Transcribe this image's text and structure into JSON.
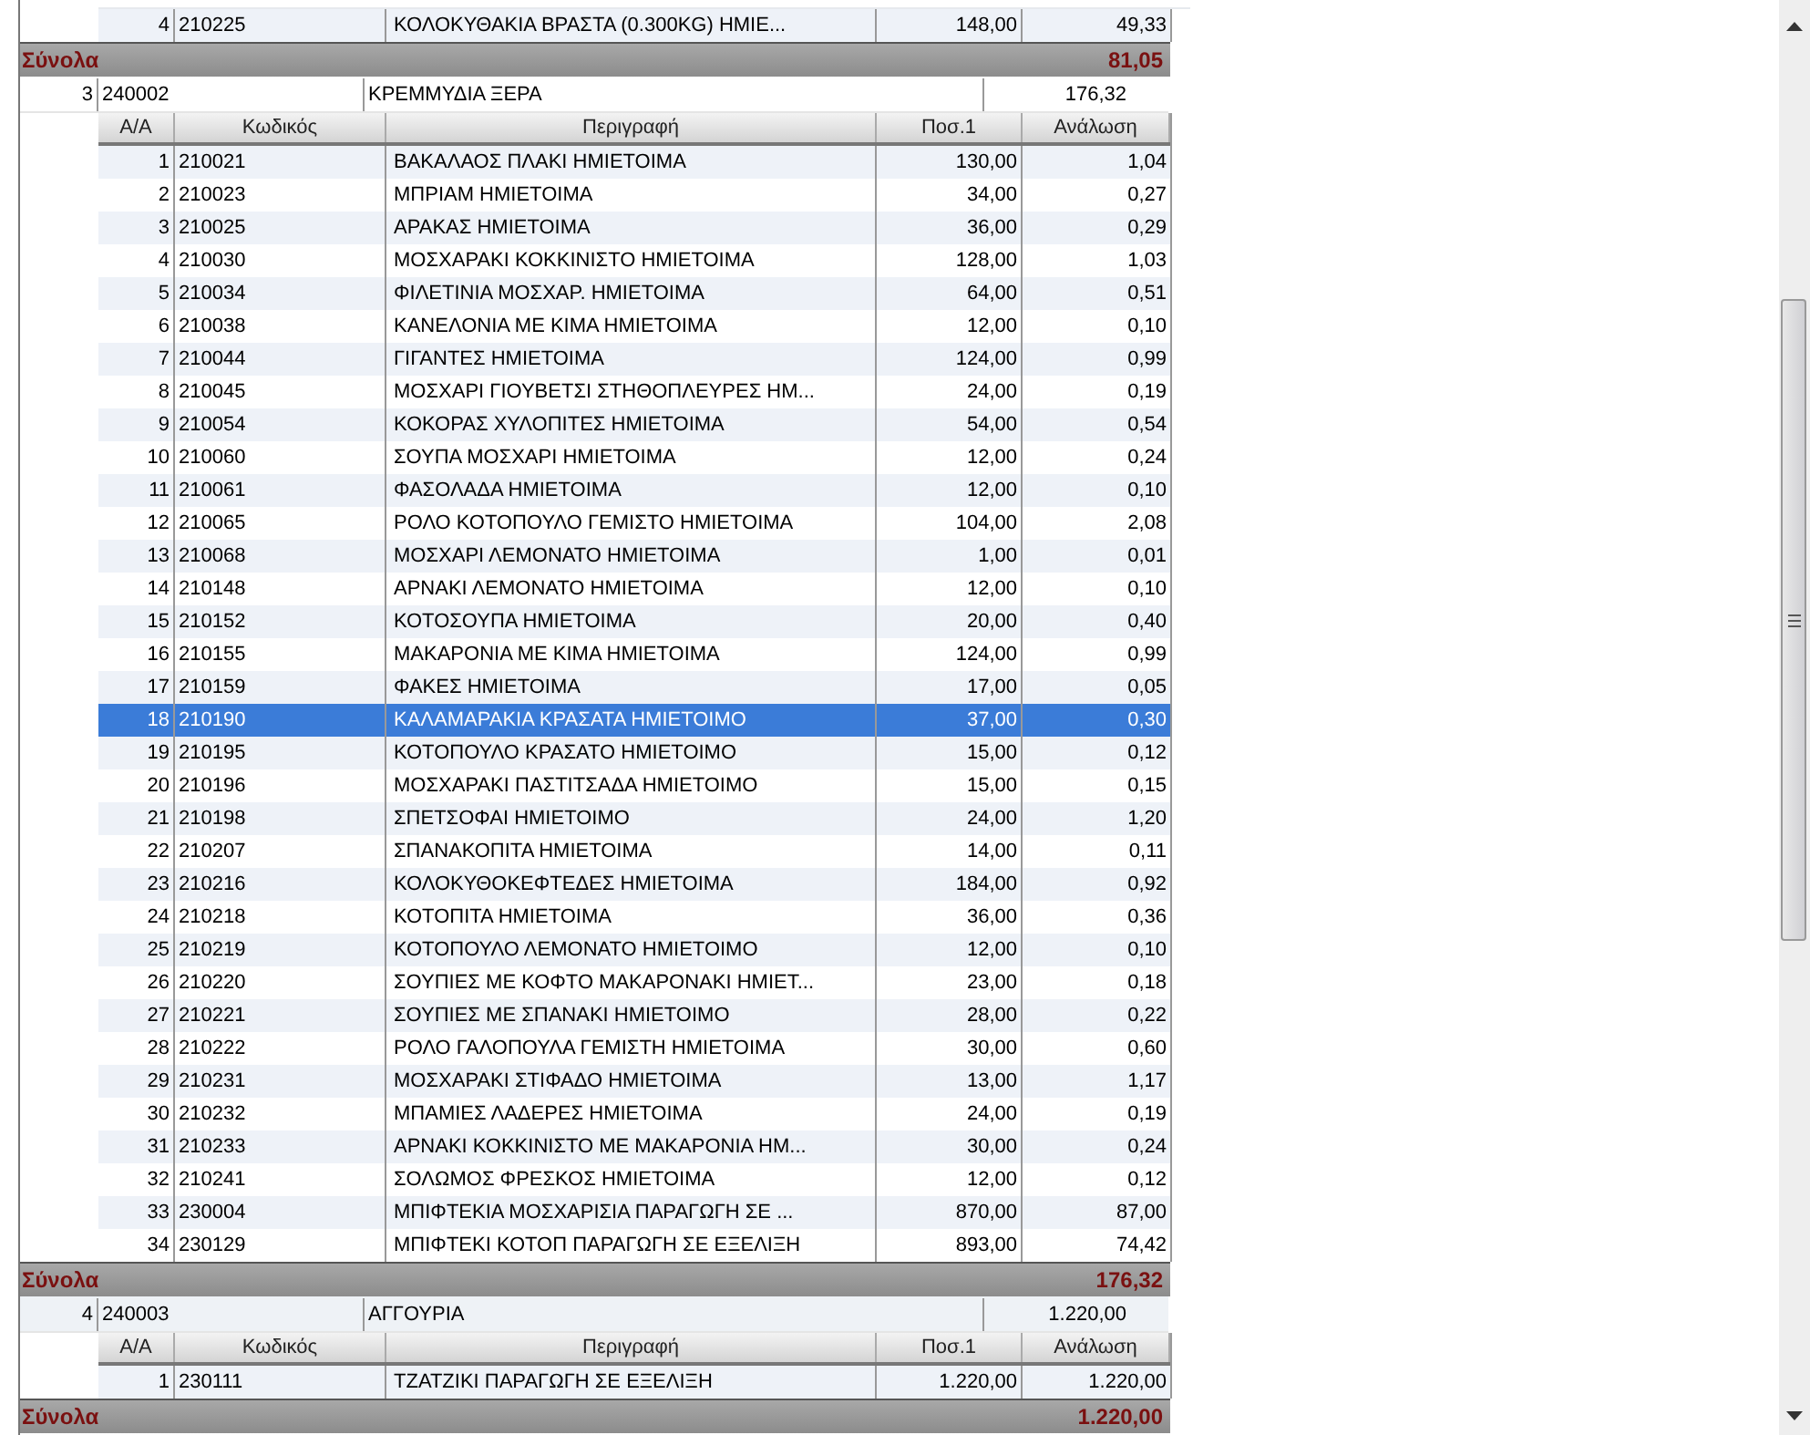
{
  "groups": [
    {
      "items": [
        {
          "aa": "4",
          "code": "210225",
          "description": "ΚΟΛΟΚΥΘΑΚΙΑ ΒΡΑΣΤΑ (0.300KG) ΗΜΙΕ...",
          "qty": "148,00",
          "consumption": "49,33",
          "selected": false
        }
      ],
      "totals": {
        "label": "Σύνολα",
        "value": "81,05"
      }
    },
    {
      "master": {
        "aa": "3",
        "code": "240002",
        "description": "ΚΡΕΜΜΥΔΙΑ ΞΕΡΑ",
        "value": "176,32"
      },
      "columns": [
        "Α/Α",
        "Κωδικός",
        "Περιγραφή",
        "Ποσ.1",
        "Ανάλωση"
      ],
      "items": [
        {
          "aa": "1",
          "code": "210021",
          "description": "ΒΑΚΑΛΑΟΣ ΠΛΑΚΙ ΗΜΙΕΤΟΙΜΑ",
          "qty": "130,00",
          "consumption": "1,04",
          "selected": false
        },
        {
          "aa": "2",
          "code": "210023",
          "description": "ΜΠΡΙΑΜ ΗΜΙΕΤΟΙΜΑ",
          "qty": "34,00",
          "consumption": "0,27",
          "selected": false
        },
        {
          "aa": "3",
          "code": "210025",
          "description": "ΑΡΑΚΑΣ ΗΜΙΕΤΟΙΜΑ",
          "qty": "36,00",
          "consumption": "0,29",
          "selected": false
        },
        {
          "aa": "4",
          "code": "210030",
          "description": "ΜΟΣΧΑΡΑΚΙ ΚΟΚΚΙΝΙΣΤΟ ΗΜΙΕΤΟΙΜΑ",
          "qty": "128,00",
          "consumption": "1,03",
          "selected": false
        },
        {
          "aa": "5",
          "code": "210034",
          "description": "ΦΙΛΕΤΙΝΙΑ ΜΟΣΧΑΡ. ΗΜΙΕΤΟΙΜΑ",
          "qty": "64,00",
          "consumption": "0,51",
          "selected": false
        },
        {
          "aa": "6",
          "code": "210038",
          "description": "ΚΑΝΕΛΟΝΙΑ ΜΕ ΚΙΜΑ ΗΜΙΕΤΟΙΜΑ",
          "qty": "12,00",
          "consumption": "0,10",
          "selected": false
        },
        {
          "aa": "7",
          "code": "210044",
          "description": "ΓΙΓΑΝΤΕΣ ΗΜΙΕΤΟΙΜΑ",
          "qty": "124,00",
          "consumption": "0,99",
          "selected": false
        },
        {
          "aa": "8",
          "code": "210045",
          "description": "ΜΟΣΧΑΡΙ ΓΙΟΥΒΕΤΣΙ ΣΤΗΘΟΠΛΕΥΡΕΣ ΗΜ...",
          "qty": "24,00",
          "consumption": "0,19",
          "selected": false
        },
        {
          "aa": "9",
          "code": "210054",
          "description": "ΚΟΚΟΡΑΣ ΧΥΛΟΠΙΤΕΣ ΗΜΙΕΤΟΙΜΑ",
          "qty": "54,00",
          "consumption": "0,54",
          "selected": false
        },
        {
          "aa": "10",
          "code": "210060",
          "description": "ΣΟΥΠΑ ΜΟΣΧΑΡΙ ΗΜΙΕΤΟΙΜΑ",
          "qty": "12,00",
          "consumption": "0,24",
          "selected": false
        },
        {
          "aa": "11",
          "code": "210061",
          "description": "ΦΑΣΟΛΑΔΑ ΗΜΙΕΤΟΙΜΑ",
          "qty": "12,00",
          "consumption": "0,10",
          "selected": false
        },
        {
          "aa": "12",
          "code": "210065",
          "description": "ΡΟΛΟ ΚΟΤΟΠΟΥΛΟ ΓΕΜΙΣΤΟ ΗΜΙΕΤΟΙΜΑ",
          "qty": "104,00",
          "consumption": "2,08",
          "selected": false
        },
        {
          "aa": "13",
          "code": "210068",
          "description": "ΜΟΣΧΑΡΙ ΛΕΜΟΝΑΤΟ ΗΜΙΕΤΟΙΜΑ",
          "qty": "1,00",
          "consumption": "0,01",
          "selected": false
        },
        {
          "aa": "14",
          "code": "210148",
          "description": "ΑΡΝΑΚΙ ΛΕΜΟΝΑΤΟ ΗΜΙΕΤΟΙΜΑ",
          "qty": "12,00",
          "consumption": "0,10",
          "selected": false
        },
        {
          "aa": "15",
          "code": "210152",
          "description": "ΚΟΤΟΣΟΥΠΑ ΗΜΙΕΤΟΙΜΑ",
          "qty": "20,00",
          "consumption": "0,40",
          "selected": false
        },
        {
          "aa": "16",
          "code": "210155",
          "description": "ΜΑΚΑΡΟΝΙΑ ΜΕ ΚΙΜΑ ΗΜΙΕΤΟΙΜΑ",
          "qty": "124,00",
          "consumption": "0,99",
          "selected": false
        },
        {
          "aa": "17",
          "code": "210159",
          "description": "ΦΑΚΕΣ ΗΜΙΕΤΟΙΜΑ",
          "qty": "17,00",
          "consumption": "0,05",
          "selected": false
        },
        {
          "aa": "18",
          "code": "210190",
          "description": "ΚΑΛΑΜΑΡΑΚΙΑ ΚΡΑΣΑΤΑ ΗΜΙΕΤΟΙΜΟ",
          "qty": "37,00",
          "consumption": "0,30",
          "selected": true
        },
        {
          "aa": "19",
          "code": "210195",
          "description": "ΚΟΤΟΠΟΥΛΟ ΚΡΑΣΑΤΟ ΗΜΙΕΤΟΙΜΟ",
          "qty": "15,00",
          "consumption": "0,12",
          "selected": false
        },
        {
          "aa": "20",
          "code": "210196",
          "description": "ΜΟΣΧΑΡΑΚΙ ΠΑΣΤΙΤΣΑΔΑ ΗΜΙΕΤΟΙΜΟ",
          "qty": "15,00",
          "consumption": "0,15",
          "selected": false
        },
        {
          "aa": "21",
          "code": "210198",
          "description": "ΣΠΕΤΣΟΦΑΙ ΗΜΙΕΤΟΙΜΟ",
          "qty": "24,00",
          "consumption": "1,20",
          "selected": false
        },
        {
          "aa": "22",
          "code": "210207",
          "description": "ΣΠΑΝΑΚΟΠΙΤΑ ΗΜΙΕΤΟΙΜΑ",
          "qty": "14,00",
          "consumption": "0,11",
          "selected": false
        },
        {
          "aa": "23",
          "code": "210216",
          "description": "ΚΟΛΟΚΥΘΟΚΕΦΤΕΔΕΣ ΗΜΙΕΤΟΙΜΑ",
          "qty": "184,00",
          "consumption": "0,92",
          "selected": false
        },
        {
          "aa": "24",
          "code": "210218",
          "description": "ΚΟΤΟΠΙΤΑ ΗΜΙΕΤΟΙΜΑ",
          "qty": "36,00",
          "consumption": "0,36",
          "selected": false
        },
        {
          "aa": "25",
          "code": "210219",
          "description": "ΚΟΤΟΠΟΥΛΟ ΛΕΜΟΝΑΤΟ ΗΜΙΕΤΟΙΜΟ",
          "qty": "12,00",
          "consumption": "0,10",
          "selected": false
        },
        {
          "aa": "26",
          "code": "210220",
          "description": "ΣΟΥΠΙΕΣ ΜΕ ΚΟΦΤΟ ΜΑΚΑΡΟΝΑΚΙ ΗΜΙΕΤ...",
          "qty": "23,00",
          "consumption": "0,18",
          "selected": false
        },
        {
          "aa": "27",
          "code": "210221",
          "description": "ΣΟΥΠΙΕΣ ΜΕ ΣΠΑΝΑΚΙ ΗΜΙΕΤΟΙΜΟ",
          "qty": "28,00",
          "consumption": "0,22",
          "selected": false
        },
        {
          "aa": "28",
          "code": "210222",
          "description": "ΡΟΛΟ ΓΑΛΟΠΟΥΛΑ ΓΕΜΙΣΤΗ ΗΜΙΕΤΟΙΜΑ",
          "qty": "30,00",
          "consumption": "0,60",
          "selected": false
        },
        {
          "aa": "29",
          "code": "210231",
          "description": "ΜΟΣΧΑΡΑΚΙ ΣΤΙΦΑΔΟ ΗΜΙΕΤΟΙΜΑ",
          "qty": "13,00",
          "consumption": "1,17",
          "selected": false
        },
        {
          "aa": "30",
          "code": "210232",
          "description": "ΜΠΑΜΙΕΣ ΛΑΔΕΡΕΣ ΗΜΙΕΤΟΙΜΑ",
          "qty": "24,00",
          "consumption": "0,19",
          "selected": false
        },
        {
          "aa": "31",
          "code": "210233",
          "description": "ΑΡΝΑΚΙ ΚΟΚΚΙΝΙΣΤΟ ΜΕ ΜΑΚΑΡΟΝΙΑ ΗΜ...",
          "qty": "30,00",
          "consumption": "0,24",
          "selected": false
        },
        {
          "aa": "32",
          "code": "210241",
          "description": "ΣΟΛΩΜΟΣ ΦΡΕΣΚΟΣ ΗΜΙΕΤΟΙΜΑ",
          "qty": "12,00",
          "consumption": "0,12",
          "selected": false
        },
        {
          "aa": "33",
          "code": "230004",
          "description": "ΜΠΙΦΤΕΚΙΑ ΜΟΣΧΑΡΙΣΙΑ ΠΑΡΑΓΩΓΗ ΣΕ ...",
          "qty": "870,00",
          "consumption": "87,00",
          "selected": false
        },
        {
          "aa": "34",
          "code": "230129",
          "description": "ΜΠΙΦΤΕΚΙ ΚΟΤΟΠ ΠΑΡΑΓΩΓΗ ΣΕ ΕΞΕΛΙΞΗ",
          "qty": "893,00",
          "consumption": "74,42",
          "selected": false
        }
      ],
      "totals": {
        "label": "Σύνολα",
        "value": "176,32"
      }
    },
    {
      "master": {
        "aa": "4",
        "code": "240003",
        "description": "ΑΓΓΟΥΡΙΑ",
        "value": "1.220,00"
      },
      "columns": [
        "Α/Α",
        "Κωδικός",
        "Περιγραφή",
        "Ποσ.1",
        "Ανάλωση"
      ],
      "items": [
        {
          "aa": "1",
          "code": "230111",
          "description": "ΤΖΑΤΖΙΚΙ ΠΑΡΑΓΩΓΗ ΣΕ ΕΞΕΛΙΞΗ",
          "qty": "1.220,00",
          "consumption": "1.220,00",
          "selected": false
        }
      ],
      "totals": {
        "label": "Σύνολα",
        "value": "1.220,00"
      }
    }
  ]
}
